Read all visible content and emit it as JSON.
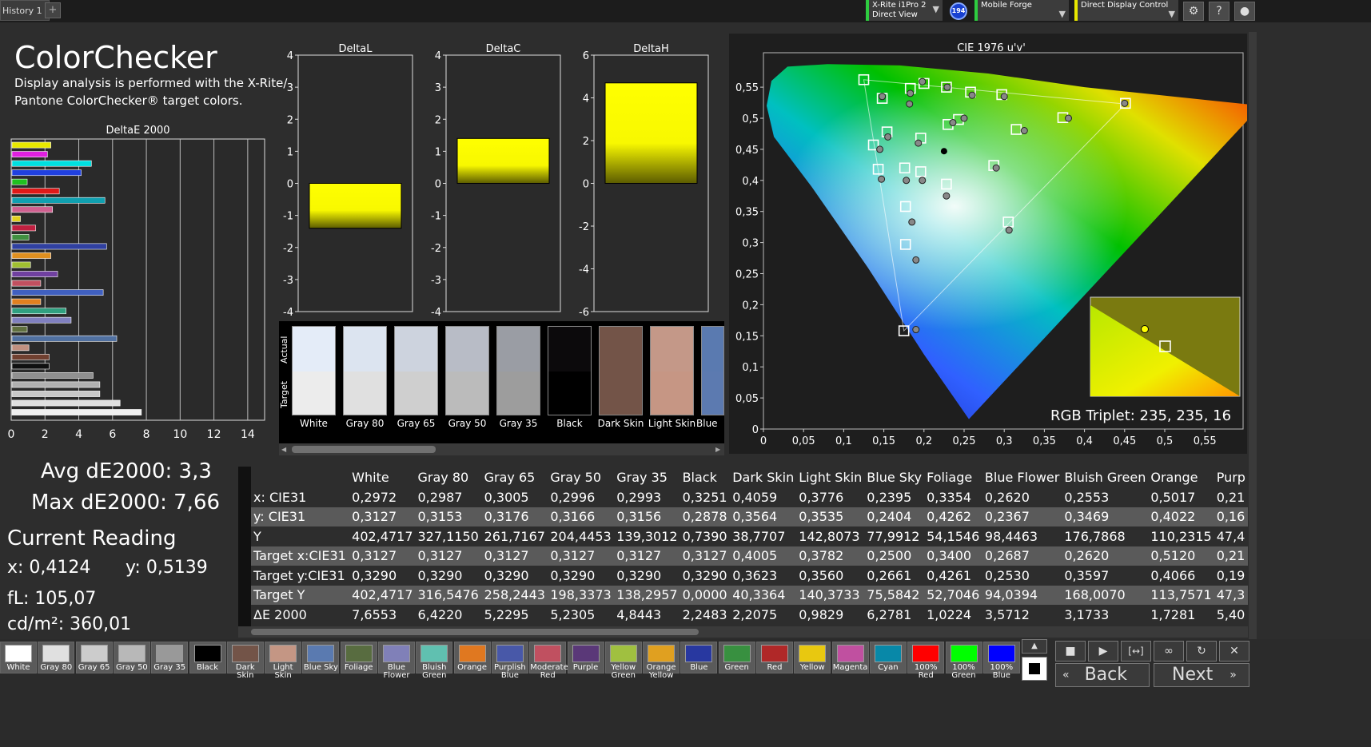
{
  "topbar": {
    "tab_label": "History 1",
    "add_tab": "+",
    "device": {
      "line1": "X-Rite i1Pro 2",
      "line2": "Direct View"
    },
    "device_badge": "194",
    "profile": "Mobile Forge",
    "mode": "Direct Display Control"
  },
  "header": {
    "title": "ColorChecker",
    "desc1": "Display analysis is performed with the X-Rite/",
    "desc2": "Pantone ColorChecker® target colors."
  },
  "deltae_chart": {
    "title": "DeltaE 2000",
    "xticks": [
      "0",
      "2",
      "4",
      "6",
      "8",
      "10",
      "12",
      "14"
    ],
    "xmax": 15,
    "bars": [
      {
        "value": 2.3,
        "color": "#e8e800"
      },
      {
        "value": 2.1,
        "color": "#e020e0"
      },
      {
        "value": 4.7,
        "color": "#00e0e0"
      },
      {
        "value": 4.1,
        "color": "#2040e0"
      },
      {
        "value": 0.9,
        "color": "#20c020"
      },
      {
        "value": 2.8,
        "color": "#e01818"
      },
      {
        "value": 5.5,
        "color": "#10a0b0"
      },
      {
        "value": 2.4,
        "color": "#d06090"
      },
      {
        "value": 0.5,
        "color": "#e0d020"
      },
      {
        "value": 1.4,
        "color": "#c02040"
      },
      {
        "value": 1.0,
        "color": "#409040"
      },
      {
        "value": 5.6,
        "color": "#3040a0"
      },
      {
        "value": 2.3,
        "color": "#e09020"
      },
      {
        "value": 1.1,
        "color": "#a0c030"
      },
      {
        "value": 2.7,
        "color": "#7040a0"
      },
      {
        "value": 1.7,
        "color": "#c05060"
      },
      {
        "value": 5.4,
        "color": "#4060c0"
      },
      {
        "value": 1.7,
        "color": "#e08020"
      },
      {
        "value": 3.2,
        "color": "#30a080"
      },
      {
        "value": 3.5,
        "color": "#8080c0"
      },
      {
        "value": 0.9,
        "color": "#607040"
      },
      {
        "value": 6.2,
        "color": "#5070a0"
      },
      {
        "value": 1.0,
        "color": "#c09080"
      },
      {
        "value": 2.2,
        "color": "#704030"
      },
      {
        "value": 2.2,
        "color": "#101010"
      },
      {
        "value": 4.8,
        "color": "#909090"
      },
      {
        "value": 5.2,
        "color": "#b0b0b0"
      },
      {
        "value": 5.2,
        "color": "#c8c8c8"
      },
      {
        "value": 6.4,
        "color": "#e0e0e0"
      },
      {
        "value": 7.66,
        "color": "#f0f0f0"
      }
    ]
  },
  "delta_charts": [
    {
      "title": "DeltaL",
      "yticks": [
        "4",
        "3",
        "2",
        "1",
        "0",
        "-1",
        "-2",
        "-3",
        "-4"
      ],
      "ymin": -4,
      "ymax": 4,
      "value": -1.4
    },
    {
      "title": "DeltaC",
      "yticks": [
        "4",
        "3",
        "2",
        "1",
        "0",
        "-1",
        "-2",
        "-3",
        "-4"
      ],
      "ymin": -4,
      "ymax": 4,
      "value": 1.4
    },
    {
      "title": "DeltaH",
      "yticks": [
        "6",
        "4",
        "2",
        "0",
        "-2",
        "-4",
        "-6"
      ],
      "ymin": -6,
      "ymax": 6,
      "value": 4.7
    }
  ],
  "swatches": {
    "actual_label": "Actual",
    "target_label": "Target",
    "items": [
      {
        "name": "White",
        "actual": "#e4ecf8",
        "target": "#ececec"
      },
      {
        "name": "Gray 80",
        "actual": "#dce4f0",
        "target": "#e0e0e0"
      },
      {
        "name": "Gray 65",
        "actual": "#cdd3de",
        "target": "#cfcfcf"
      },
      {
        "name": "Gray 50",
        "actual": "#b8bcc6",
        "target": "#bbbbbb"
      },
      {
        "name": "Gray 35",
        "actual": "#9a9da4",
        "target": "#9d9d9d"
      },
      {
        "name": "Black",
        "actual": "#0c0a0c",
        "target": "#000000"
      },
      {
        "name": "Dark Skin",
        "actual": "#735448",
        "target": "#735448"
      },
      {
        "name": "Light Skin",
        "actual": "#c49888",
        "target": "#c69684"
      },
      {
        "name": "Blue",
        "actual": "#5a7ab0",
        "target": "#5c7ab0"
      }
    ]
  },
  "cie": {
    "title": "CIE 1976 u'v'",
    "xticks": [
      "0",
      "0,05",
      "0,1",
      "0,15",
      "0,2",
      "0,25",
      "0,3",
      "0,35",
      "0,4",
      "0,45",
      "0,5",
      "0,55"
    ],
    "yticks": [
      "0,55",
      "0,5",
      "0,45",
      "0,4",
      "0,35",
      "0,3",
      "0,25",
      "0,2",
      "0,15",
      "0,1",
      "0,05",
      "0"
    ],
    "rgb_triplet": "RGB Triplet: 235, 235, 16",
    "targets": [
      [
        0.125,
        0.562
      ],
      [
        0.148,
        0.532
      ],
      [
        0.183,
        0.548
      ],
      [
        0.2,
        0.556
      ],
      [
        0.228,
        0.55
      ],
      [
        0.258,
        0.542
      ],
      [
        0.297,
        0.538
      ],
      [
        0.373,
        0.501
      ],
      [
        0.451,
        0.524
      ],
      [
        0.243,
        0.498
      ],
      [
        0.23,
        0.49
      ],
      [
        0.315,
        0.482
      ],
      [
        0.154,
        0.478
      ],
      [
        0.196,
        0.468
      ],
      [
        0.137,
        0.457
      ],
      [
        0.143,
        0.418
      ],
      [
        0.176,
        0.42
      ],
      [
        0.196,
        0.414
      ],
      [
        0.228,
        0.394
      ],
      [
        0.287,
        0.424
      ],
      [
        0.177,
        0.358
      ],
      [
        0.305,
        0.333
      ],
      [
        0.177,
        0.297
      ],
      [
        0.175,
        0.158
      ]
    ],
    "actuals": [
      [
        0.148,
        0.535
      ],
      [
        0.183,
        0.54
      ],
      [
        0.182,
        0.523
      ],
      [
        0.198,
        0.559
      ],
      [
        0.229,
        0.55
      ],
      [
        0.26,
        0.537
      ],
      [
        0.3,
        0.535
      ],
      [
        0.38,
        0.5
      ],
      [
        0.45,
        0.524
      ],
      [
        0.25,
        0.5
      ],
      [
        0.236,
        0.493
      ],
      [
        0.325,
        0.48
      ],
      [
        0.155,
        0.47
      ],
      [
        0.193,
        0.46
      ],
      [
        0.145,
        0.45
      ],
      [
        0.147,
        0.402
      ],
      [
        0.178,
        0.4
      ],
      [
        0.198,
        0.4
      ],
      [
        0.228,
        0.375
      ],
      [
        0.29,
        0.42
      ],
      [
        0.185,
        0.333
      ],
      [
        0.306,
        0.32
      ],
      [
        0.19,
        0.272
      ],
      [
        0.19,
        0.16
      ]
    ],
    "current": [
      0.225,
      0.447
    ]
  },
  "stats": {
    "avg": "Avg dE2000: 3,3",
    "max": "Max dE2000: 7,66",
    "current_heading": "Current Reading",
    "x": "x: 0,4124",
    "y": "y: 0,5139",
    "fl": "fL: 105,07",
    "cdm": "cd/m²: 360,01"
  },
  "table": {
    "columns": [
      "",
      "White",
      "Gray 80",
      "Gray 65",
      "Gray 50",
      "Gray 35",
      "Black",
      "Dark Skin",
      "Light Skin",
      "Blue Sky",
      "Foliage",
      "Blue Flower",
      "Bluish Green",
      "Orange",
      "Purp"
    ],
    "rows": [
      [
        "x: CIE31",
        "0,2972",
        "0,2987",
        "0,3005",
        "0,2996",
        "0,2993",
        "0,3251",
        "0,4059",
        "0,3776",
        "0,2395",
        "0,3354",
        "0,2620",
        "0,2553",
        "0,5017",
        "0,21"
      ],
      [
        "y: CIE31",
        "0,3127",
        "0,3153",
        "0,3176",
        "0,3166",
        "0,3156",
        "0,2878",
        "0,3564",
        "0,3535",
        "0,2404",
        "0,4262",
        "0,2367",
        "0,3469",
        "0,4022",
        "0,16"
      ],
      [
        "Y",
        "402,4717",
        "327,1150",
        "261,7167",
        "204,4453",
        "139,3012",
        "0,7390",
        "38,7707",
        "142,8073",
        "77,9912",
        "54,1546",
        "98,4463",
        "176,7868",
        "110,2315",
        "47,4"
      ],
      [
        "Target x:CIE31",
        "0,3127",
        "0,3127",
        "0,3127",
        "0,3127",
        "0,3127",
        "0,3127",
        "0,4005",
        "0,3782",
        "0,2500",
        "0,3400",
        "0,2687",
        "0,2620",
        "0,5120",
        "0,21"
      ],
      [
        "Target y:CIE31",
        "0,3290",
        "0,3290",
        "0,3290",
        "0,3290",
        "0,3290",
        "0,3290",
        "0,3623",
        "0,3560",
        "0,2661",
        "0,4261",
        "0,2530",
        "0,3597",
        "0,4066",
        "0,19"
      ],
      [
        "Target Y",
        "402,4717",
        "316,5476",
        "258,2443",
        "198,3373",
        "138,2957",
        "0,0000",
        "40,3364",
        "140,3733",
        "75,5842",
        "52,7046",
        "94,0394",
        "168,0070",
        "113,7571",
        "47,3"
      ],
      [
        "ΔE 2000",
        "7,6553",
        "6,4220",
        "5,2295",
        "5,2305",
        "4,8443",
        "2,2483",
        "2,2075",
        "0,9829",
        "6,2781",
        "1,0224",
        "3,5712",
        "3,1733",
        "1,7281",
        "5,40"
      ]
    ]
  },
  "bottom_swatches": [
    {
      "label": "White",
      "color": "#ffffff"
    },
    {
      "label": "Gray 80",
      "color": "#e0e0e0"
    },
    {
      "label": "Gray 65",
      "color": "#cccccc"
    },
    {
      "label": "Gray 50",
      "color": "#b8b8b8"
    },
    {
      "label": "Gray 35",
      "color": "#999999"
    },
    {
      "label": "Black",
      "color": "#000000"
    },
    {
      "label": "Dark Skin",
      "color": "#735448"
    },
    {
      "label": "Light Skin",
      "color": "#c49684"
    },
    {
      "label": "Blue Sky",
      "color": "#5a7ab0"
    },
    {
      "label": "Foliage",
      "color": "#586c40"
    },
    {
      "label": "Blue Flower",
      "color": "#8080b8"
    },
    {
      "label": "Bluish Green",
      "color": "#60c0b0"
    },
    {
      "label": "Orange",
      "color": "#e07820"
    },
    {
      "label": "Purplish Blue",
      "color": "#4858a8"
    },
    {
      "label": "Moderate Red",
      "color": "#c05060"
    },
    {
      "label": "Purple",
      "color": "#5a3878"
    },
    {
      "label": "Yellow Green",
      "color": "#a0c040"
    },
    {
      "label": "Orange Yellow",
      "color": "#e0a020"
    },
    {
      "label": "Blue",
      "color": "#2838a0"
    },
    {
      "label": "Green",
      "color": "#389040"
    },
    {
      "label": "Red",
      "color": "#b02828"
    },
    {
      "label": "Yellow",
      "color": "#e8c810"
    },
    {
      "label": "Magenta",
      "color": "#c050a0"
    },
    {
      "label": "Cyan",
      "color": "#0888a8"
    },
    {
      "label": "100% Red",
      "color": "#ff0000"
    },
    {
      "label": "100% Green",
      "color": "#00ff00"
    },
    {
      "label": "100% Blue",
      "color": "#0000ff"
    }
  ],
  "nav": {
    "back": "Back",
    "next": "Next"
  }
}
